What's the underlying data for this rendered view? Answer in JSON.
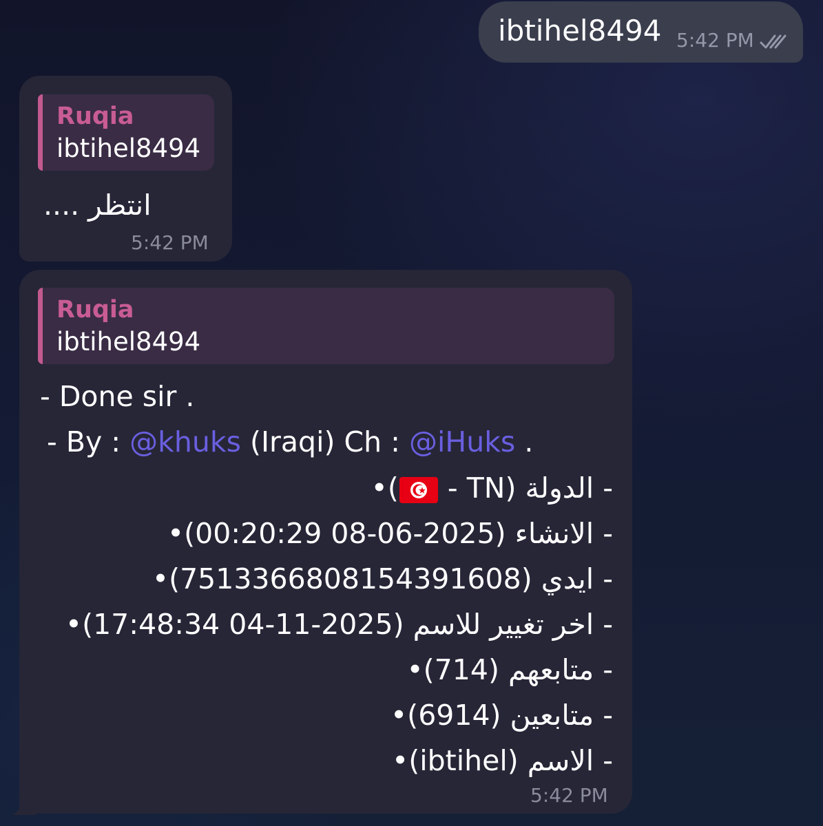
{
  "conversation": {
    "outgoing": {
      "text": "ibtihel8494",
      "time": "5:42 PM",
      "status_icon": "double-check-icon"
    },
    "incoming_1": {
      "reply_name": "Ruqia",
      "reply_text": "ibtihel8494",
      "text": "انتظر ....",
      "time": "5:42 PM"
    },
    "incoming_2": {
      "reply_name": "Ruqia",
      "reply_text": "ibtihel8494",
      "done_line": "- Done sir .",
      "by": {
        "prefix": "- By : ",
        "mention_1": "@khuks",
        "middle": " (Iraqi) Ch : ",
        "mention_2": "@iHuks",
        "suffix": " ."
      },
      "country": {
        "prefix": "- الدولة (TN - ",
        "flag_icon": "tunisia-flag-icon",
        "suffix": ")•"
      },
      "lines": [
        "- الانشاء (2025-06-08 00:20:29)•",
        "- ايدي (7513366808154391608)•",
        "- اخر تغيير للاسم (2025-11-04 17:48:34)•",
        "- متابعهم (714)•",
        "- متابعين (6914)•",
        "- الاسم (ibtihel)•"
      ],
      "time": "5:42 PM"
    }
  },
  "colors": {
    "background": "#141a33",
    "outgoing_bubble": "#3a3e4d",
    "incoming_bubble": "#262637",
    "reply_background": "#3a2c45",
    "reply_accent": "#c25a8f",
    "reply_name": "#c85c93",
    "mention": "#6a5fe0",
    "timestamp": "#8a8c9c"
  }
}
